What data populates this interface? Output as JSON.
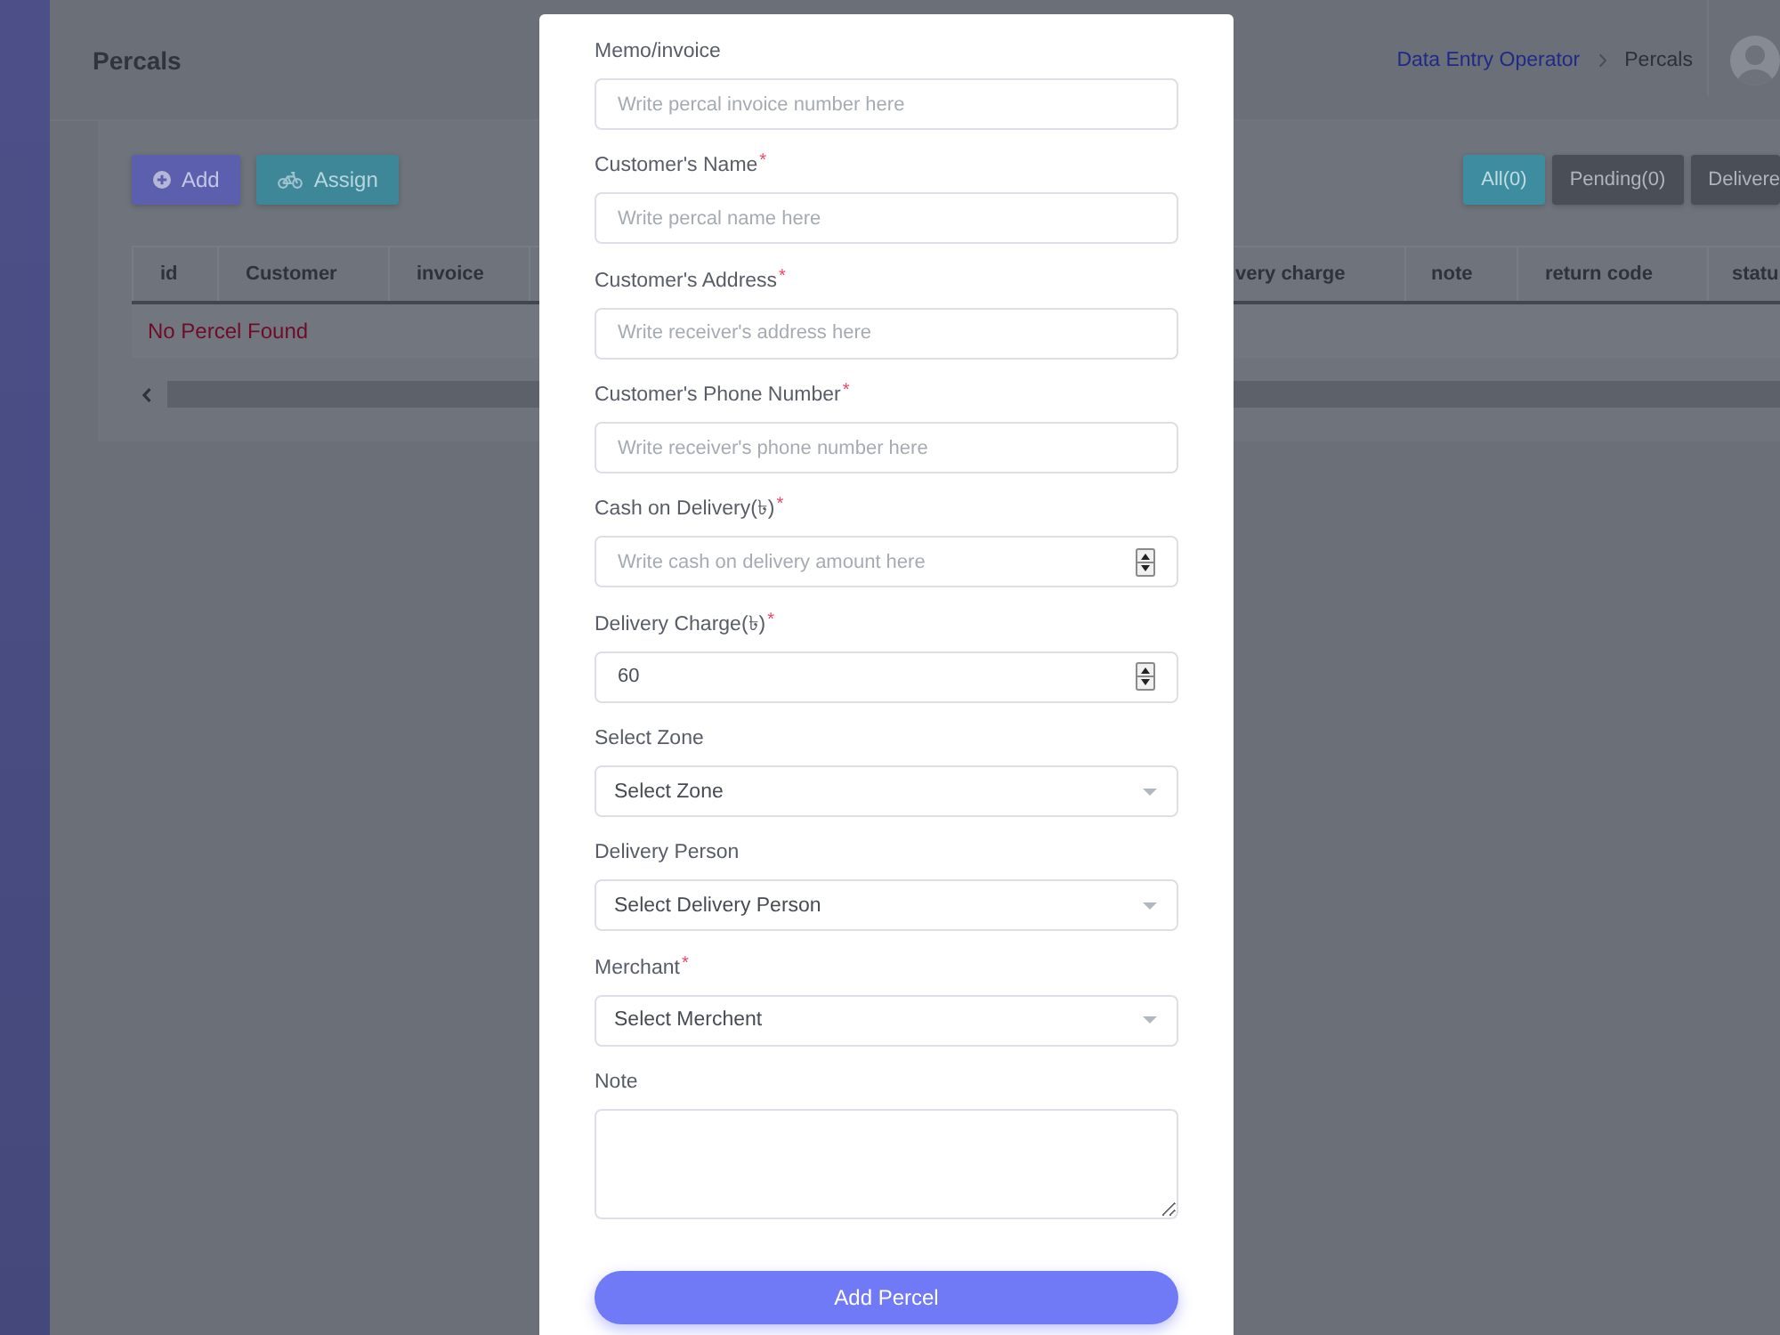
{
  "header": {
    "title": "Percals",
    "breadcrumb": [
      {
        "label": "Data Entry Operator",
        "kind": "link"
      },
      {
        "label": "Percals",
        "kind": "current"
      }
    ]
  },
  "toolbar": {
    "actions": [
      {
        "label": "Add",
        "kind": "add"
      },
      {
        "label": "Assign",
        "kind": "assign"
      }
    ],
    "filters": [
      {
        "label": "All(0)",
        "selected": true
      },
      {
        "label": "Pending(0)",
        "selected": false
      },
      {
        "label": "Delivere",
        "selected": false
      }
    ]
  },
  "table": {
    "columns": [
      "id",
      "Customer",
      "invoice",
      "very charge",
      "note",
      "return code",
      "statu"
    ],
    "empty_message": "No Percel Found"
  },
  "form": {
    "fields": [
      {
        "kind": "text",
        "label": "Memo/invoice",
        "placeholder": "Write percal invoice number here"
      },
      {
        "kind": "text",
        "label": "Customer's Name",
        "mark": "*",
        "placeholder": "Write percal name here"
      },
      {
        "kind": "text",
        "label": "Customer's Address",
        "mark": "*",
        "placeholder": "Write receiver's address here"
      },
      {
        "kind": "text",
        "label": "Customer's Phone Number",
        "mark": "*",
        "placeholder": "Write receiver's phone number here"
      },
      {
        "kind": "number",
        "label": "Cash on Delivery(৳)",
        "mark": "*",
        "placeholder": "Write cash on delivery amount here"
      },
      {
        "kind": "number",
        "label": "Delivery Charge(৳)",
        "mark": "*",
        "value": "60"
      },
      {
        "kind": "select",
        "label": "Select Zone",
        "value": "Select Zone"
      },
      {
        "kind": "select",
        "label": "Delivery Person",
        "value": "Select Delivery Person"
      },
      {
        "kind": "select",
        "label": "Merchant",
        "mark": "*",
        "value": "Select Merchent"
      },
      {
        "kind": "textarea",
        "label": "Note"
      }
    ],
    "submit": "Add Percel"
  }
}
